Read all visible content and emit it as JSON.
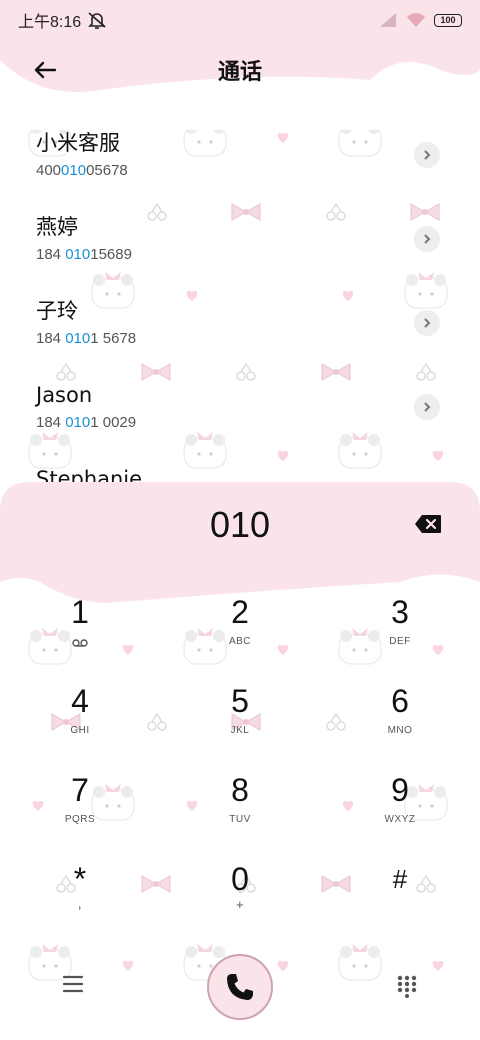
{
  "status_bar": {
    "time": "上午8:16",
    "battery": "100"
  },
  "header": {
    "title": "通话"
  },
  "contacts": [
    {
      "name": "小米客服",
      "number_pre": "400",
      "number_match": "010",
      "number_post": "05678"
    },
    {
      "name": "燕婷",
      "number_pre": "184 ",
      "number_match": "010",
      "number_post": "15689"
    },
    {
      "name": "子玲",
      "number_pre": "184 ",
      "number_match": "010",
      "number_post": "1 5678"
    },
    {
      "name": "Jason",
      "number_pre": "184 ",
      "number_match": "010",
      "number_post": "1 0029"
    },
    {
      "name": "Stephanie",
      "number_pre": "",
      "number_match": "",
      "number_post": ""
    }
  ],
  "dialer": {
    "entry": "010",
    "keys": [
      {
        "digit": "1",
        "letters": "voicemail-icon"
      },
      {
        "digit": "2",
        "letters": "ABC"
      },
      {
        "digit": "3",
        "letters": "DEF"
      },
      {
        "digit": "4",
        "letters": "GHI"
      },
      {
        "digit": "5",
        "letters": "JKL"
      },
      {
        "digit": "6",
        "letters": "MNO"
      },
      {
        "digit": "7",
        "letters": "PQRS"
      },
      {
        "digit": "8",
        "letters": "TUV"
      },
      {
        "digit": "9",
        "letters": "WXYZ"
      },
      {
        "digit": "*",
        "letters": ","
      },
      {
        "digit": "0",
        "letters": "+"
      },
      {
        "digit": "#",
        "letters": ""
      }
    ]
  },
  "colors": {
    "pink": "#fbe3ea",
    "highlight": "#1a8fd6"
  }
}
